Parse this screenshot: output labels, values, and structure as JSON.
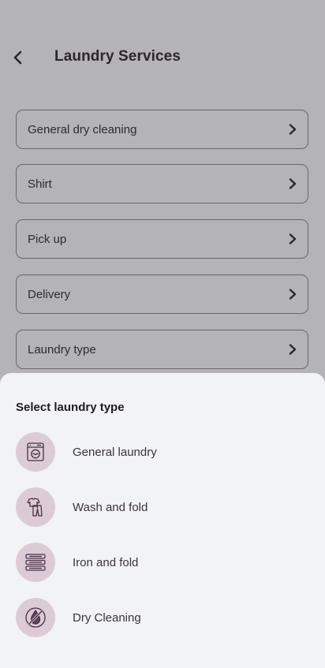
{
  "header": {
    "title": "Laundry Services",
    "back_icon": "chevron-left-icon"
  },
  "menu": {
    "items": [
      {
        "label": "General dry cleaning",
        "icon": "chevron-right-icon"
      },
      {
        "label": "Shirt",
        "icon": "chevron-right-icon"
      },
      {
        "label": "Pick up",
        "icon": "chevron-right-icon"
      },
      {
        "label": "Delivery",
        "icon": "chevron-right-icon"
      },
      {
        "label": "Laundry type",
        "icon": "chevron-right-icon"
      }
    ]
  },
  "sheet": {
    "title": "Select laundry type",
    "options": [
      {
        "label": "General laundry",
        "icon": "washing-machine-icon"
      },
      {
        "label": "Wash and fold",
        "icon": "clothes-icon"
      },
      {
        "label": "Iron and fold",
        "icon": "folded-towels-icon"
      },
      {
        "label": "Dry Cleaning",
        "icon": "no-water-drop-icon"
      }
    ]
  },
  "colors": {
    "overlay_background": "#b4b3b5",
    "sheet_background": "#f2f3f7",
    "icon_circle": "#dccbd7",
    "icon_stroke": "#4a2f45",
    "text_dark": "#2d2530"
  }
}
